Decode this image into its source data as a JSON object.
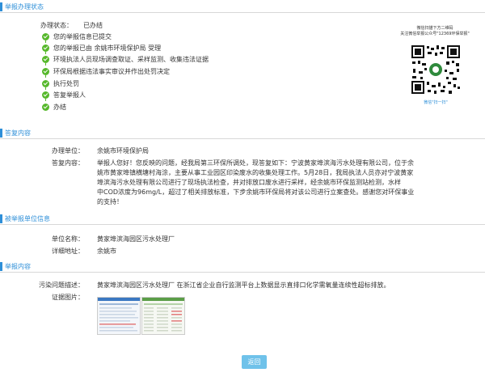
{
  "sections": {
    "status": "举报办理状态",
    "reply": "答复内容",
    "reported": "被举报单位信息",
    "content": "举报内容"
  },
  "status": {
    "label": "办理状态：",
    "value": "已办结",
    "steps": [
      "您的举报信息已提交",
      "您的举报已由 余姚市环境保护局 受理",
      "环境执法人员现场调查取证、采样监测、收集违法证据",
      "环保局根据违法事实审议并作出处罚决定",
      "执行处罚",
      "答复举报人",
      "办结"
    ]
  },
  "qr": {
    "caption_top": "微信扫描下方二维码",
    "caption_top2": "关注微信举报公众号\"12369环保举报\"",
    "caption_bottom": "微信\"扫一扫\""
  },
  "reply": {
    "unit_label": "办理单位：",
    "unit_value": "余姚市环境保护局",
    "content_label": "答复内容：",
    "content_lines": [
      "举报人您好！您反映的问题，经我局第三环保所调处，现答复如下：宁波黄家埠滨海污水处理有限公司，位于余",
      "姚市黄家埠镇横塘村海涂，主要从事工业园区印染废水的收集处理工作。5月28日，我局执法人员亦对宁波黄家",
      "埠滨海污水处理有限公司进行了现场执法检查，并对排放口废水进行采样，经余姚市环保监测站检测，水样",
      "中COD浓度为96mg/L，超过了相关排放标准，下步余姚市环保局将对该公司进行立案查处。感谢您对环保事业",
      "的支持！"
    ]
  },
  "reported": {
    "name_label": "单位名称：",
    "name_value": "黄家埠滨海园区污水处理厂",
    "addr_label": "详细地址：",
    "addr_value": "余姚市"
  },
  "content": {
    "problem_label": "污染问题描述：",
    "problem_value": "黄家埠滨海园区污水处理厂 在浙江省企业自行监测平台上数据显示直排口化学需氧量连续性超标排放。",
    "images_label": "证据图片："
  },
  "back_button": "返回",
  "colors": {
    "accent": "#2e8fd8",
    "check": "#56b82b",
    "button": "#6fc2ea"
  }
}
